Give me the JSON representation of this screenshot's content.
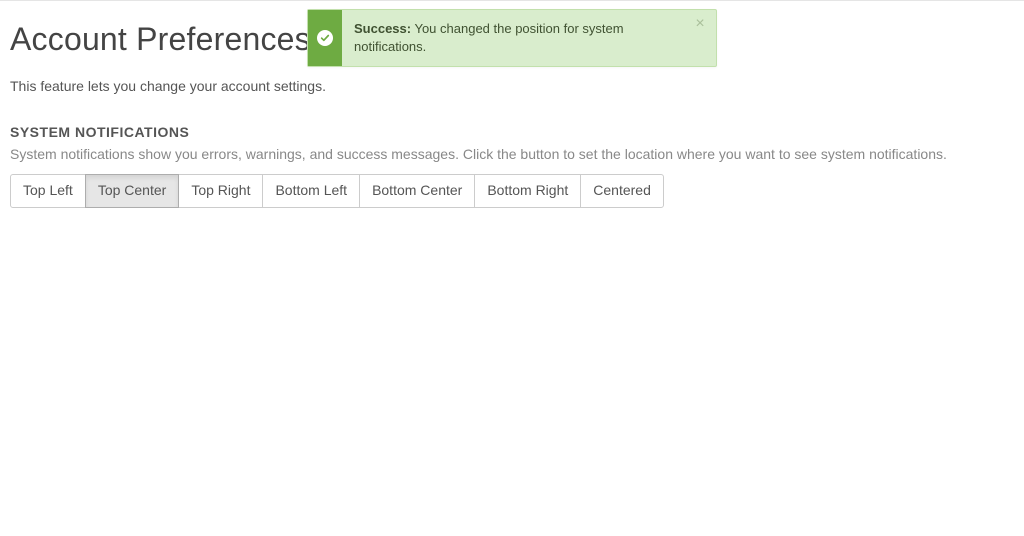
{
  "header": {
    "title": "Account Preferences",
    "description": "This feature lets you change your account settings."
  },
  "notifications": {
    "heading": "SYSTEM NOTIFICATIONS",
    "description": "System notifications show you errors, warnings, and success messages. Click the button to set the location where you want to see system notifications.",
    "active": "Top Center",
    "buttons": [
      {
        "label": "Top Left"
      },
      {
        "label": "Top Center"
      },
      {
        "label": "Top Right"
      },
      {
        "label": "Bottom Left"
      },
      {
        "label": "Bottom Center"
      },
      {
        "label": "Bottom Right"
      },
      {
        "label": "Centered"
      }
    ]
  },
  "toast": {
    "status": "success",
    "strong": "Success:",
    "message": " You changed the position for system notifications."
  },
  "colors": {
    "success_bg": "#d9edcd",
    "success_border": "#c2e0ac",
    "success_icon_bg": "#6eab42",
    "button_active_bg": "#e6e6e6"
  }
}
